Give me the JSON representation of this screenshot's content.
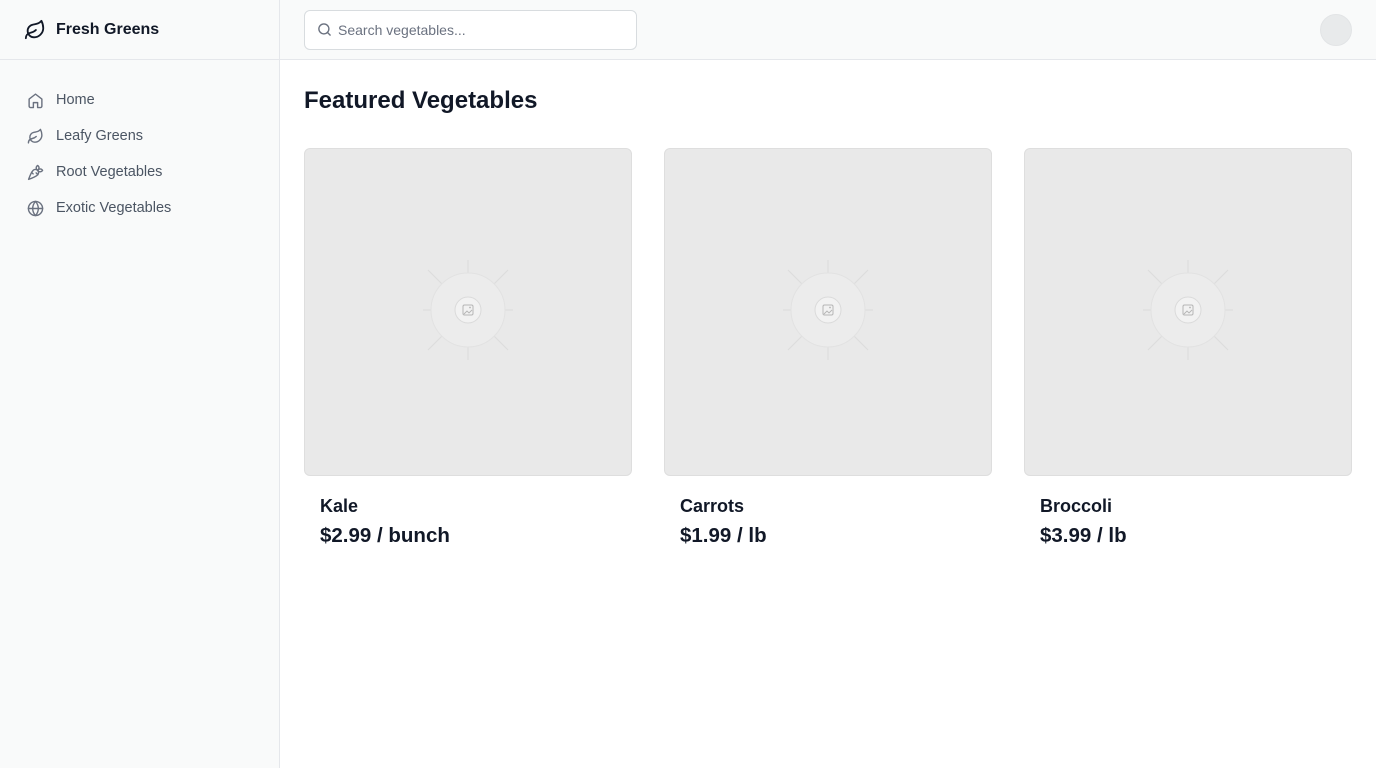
{
  "brand": {
    "title": "Fresh Greens",
    "icon": "leaf-icon"
  },
  "sidebar": {
    "items": [
      {
        "label": "Home",
        "icon": "home-icon"
      },
      {
        "label": "Leafy Greens",
        "icon": "leaf-icon"
      },
      {
        "label": "Root Vegetables",
        "icon": "carrot-icon"
      },
      {
        "label": "Exotic Vegetables",
        "icon": "globe-icon"
      }
    ]
  },
  "header": {
    "search": {
      "placeholder": "Search vegetables...",
      "value": "",
      "icon": "search-icon"
    },
    "avatar": {
      "icon": "user-avatar"
    }
  },
  "main": {
    "title": "Featured Vegetables",
    "products": [
      {
        "name": "Kale",
        "price": "$2.99 / bunch",
        "image": "image-placeholder-icon"
      },
      {
        "name": "Carrots",
        "price": "$1.99 / lb",
        "image": "image-placeholder-icon"
      },
      {
        "name": "Broccoli",
        "price": "$3.99 / lb",
        "image": "image-placeholder-icon"
      }
    ]
  },
  "colors": {
    "sidebar_bg": "#f9fafa",
    "border": "#e5e7eb",
    "text": "#111827",
    "muted_text": "#4b5563",
    "placeholder_bg": "#e9e9e9"
  }
}
